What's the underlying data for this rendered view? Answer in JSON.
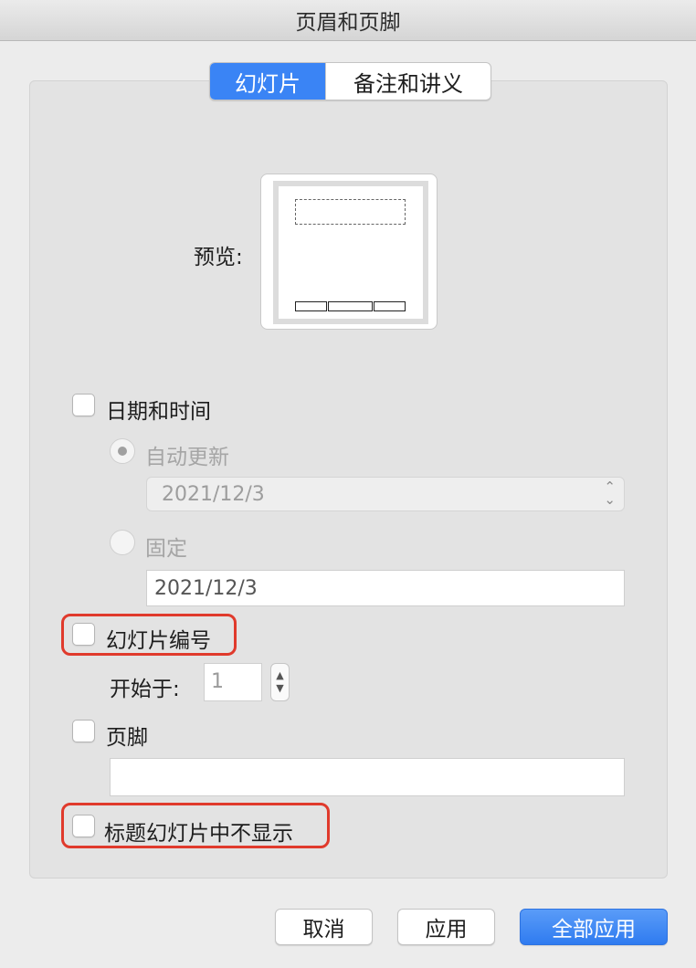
{
  "window": {
    "title": "页眉和页脚"
  },
  "tabs": [
    {
      "label": "幻灯片",
      "active": true
    },
    {
      "label": "备注和讲义",
      "active": false
    }
  ],
  "preview": {
    "label": "预览:"
  },
  "date_time": {
    "label": "日期和时间",
    "checked": false,
    "auto_update": {
      "label": "自动更新",
      "selected": true,
      "value": "2021/12/3"
    },
    "fixed": {
      "label": "固定",
      "selected": false,
      "value": "2021/12/3"
    }
  },
  "slide_number": {
    "label": "幻灯片编号",
    "checked": false,
    "start_label": "开始于:",
    "start_value": "1"
  },
  "footer": {
    "label": "页脚",
    "checked": false,
    "value": ""
  },
  "hide_on_title": {
    "label": "标题幻灯片中不显示",
    "checked": false
  },
  "buttons": {
    "cancel": "取消",
    "apply": "应用",
    "apply_all": "全部应用"
  },
  "colors": {
    "accent": "#3a84f5",
    "highlight": "#e03a2c"
  }
}
